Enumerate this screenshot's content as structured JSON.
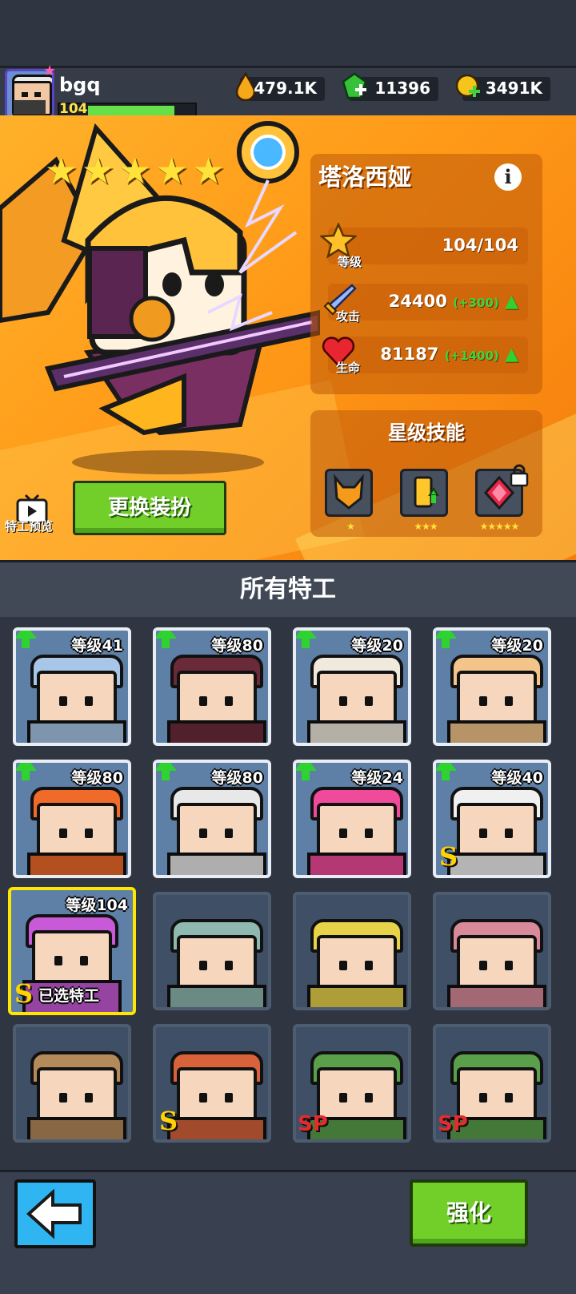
{
  "player": {
    "name": "bgq",
    "level": "104"
  },
  "resources": [
    {
      "icon": "oil-drop-icon",
      "value": "479.1K"
    },
    {
      "icon": "green-gem-icon",
      "value": "11396"
    },
    {
      "icon": "gold-coin-icon",
      "value": "3491K"
    }
  ],
  "hero": {
    "name": "塔洛西娅",
    "stars": 5,
    "stats": {
      "level_label": "等级",
      "level_value": "104/104",
      "attack_label": "攻击",
      "attack_value": "24400",
      "attack_bonus": "(+300)",
      "hp_label": "生命",
      "hp_value": "81187",
      "hp_bonus": "(+1400)"
    },
    "skills_title": "星级技能",
    "skills": [
      {
        "icon": "fox-mask-icon",
        "stars": "★"
      },
      {
        "icon": "battery-up-icon",
        "stars": "★★★"
      },
      {
        "icon": "red-gem-icon",
        "stars": "★★★★★",
        "locked": true
      }
    ],
    "preview_label": "特工预览",
    "change_outfit_label": "更换装扮"
  },
  "agents_title": "所有特工",
  "agents": [
    {
      "level": "等级41",
      "upgrade": true,
      "color": "#a8c6e8"
    },
    {
      "level": "等级80",
      "upgrade": true,
      "color": "#6a2a3a"
    },
    {
      "level": "等级20",
      "upgrade": true,
      "color": "#f0eadc"
    },
    {
      "level": "等级20",
      "upgrade": true,
      "color": "#f3c58a"
    },
    {
      "level": "等级80",
      "upgrade": true,
      "color": "#f06a2a"
    },
    {
      "level": "等级80",
      "upgrade": true,
      "color": "#e8e8e8"
    },
    {
      "level": "等级24",
      "upgrade": true,
      "color": "#f04a9a"
    },
    {
      "level": "等级40",
      "upgrade": true,
      "color": "#f0f0f0",
      "badge": "S"
    },
    {
      "level": "等级104",
      "upgrade": false,
      "color": "#c85ad8",
      "badge": "S",
      "selected": true,
      "selected_label": "已选特工"
    },
    {
      "level": "",
      "upgrade": false,
      "color": "#8fb8b0",
      "locked": true
    },
    {
      "level": "",
      "upgrade": false,
      "color": "#e6d34a",
      "locked": true
    },
    {
      "level": "",
      "upgrade": false,
      "color": "#d88a9a",
      "locked": true
    },
    {
      "level": "",
      "upgrade": false,
      "color": "#b58a5a",
      "locked": true
    },
    {
      "level": "",
      "upgrade": false,
      "color": "#d8623a",
      "locked": true,
      "badge": "S"
    },
    {
      "level": "",
      "upgrade": false,
      "color": "#5aa04a",
      "locked": true,
      "badge": "SP"
    },
    {
      "level": "",
      "upgrade": false,
      "color": "#5aa04a",
      "locked": true,
      "badge": "SP"
    }
  ],
  "bottom": {
    "back_icon": "left-arrow-icon",
    "strengthen_label": "强化"
  }
}
